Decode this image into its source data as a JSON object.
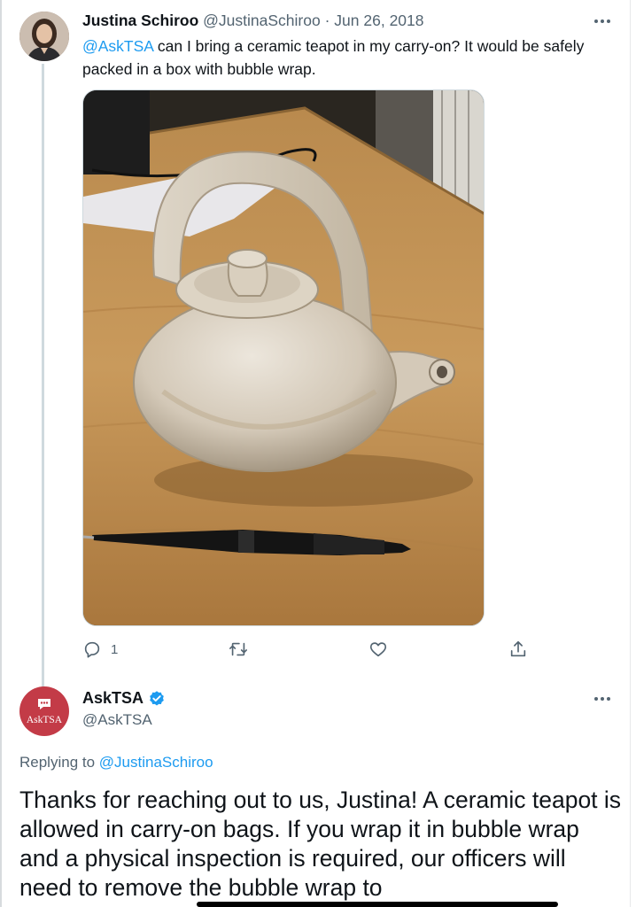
{
  "tweet": {
    "author_name": "Justina Schiroo",
    "author_handle": "@JustinaSchiroo",
    "separator": "·",
    "date": "Jun 26, 2018",
    "mention": "@AskTSA",
    "text": " can I bring a ceramic teapot in my carry-on? It would be safely packed in a box with bubble wrap.",
    "media_alt": "Photo of a ceramic teapot with a pen on a wooden table",
    "reply_count": "1",
    "icons": {
      "reply": "reply-icon",
      "retweet": "retweet-icon",
      "like": "heart-icon",
      "share": "share-icon",
      "more": "more-icon"
    }
  },
  "reply": {
    "author_name": "AskTSA",
    "author_handle": "@AskTSA",
    "avatar_label": "AskTSA",
    "verified": true,
    "replying_to_prefix": "Replying to ",
    "replying_to_handle": "@JustinaSchiroo",
    "text": "Thanks for reaching out to us, Justina! A ceramic teapot is allowed in carry-on bags. If you wrap it in bubble wrap and a physical inspection is required, our officers will need to remove the bubble wrap to"
  },
  "colors": {
    "link": "#1d9bf0",
    "secondary_text": "#536471",
    "verified_badge": "#1d9bf0",
    "tsa_avatar": "#c33b47"
  }
}
